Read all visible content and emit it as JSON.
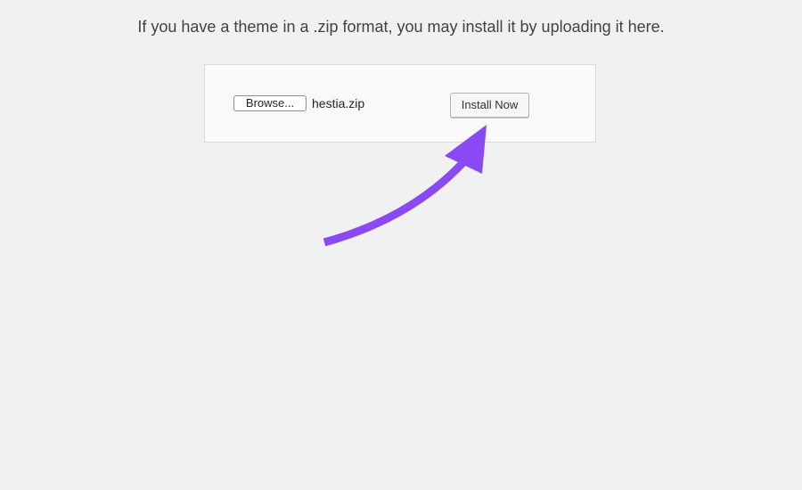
{
  "instructions": {
    "text": "If you have a theme in a .zip format, you may install it by uploading it here."
  },
  "upload": {
    "browse_label": "Browse...",
    "file_name": "hestia.zip",
    "install_label": "Install Now"
  },
  "annotation": {
    "arrow_icon": "curved-arrow-icon",
    "arrow_color": "#8a4af3"
  }
}
